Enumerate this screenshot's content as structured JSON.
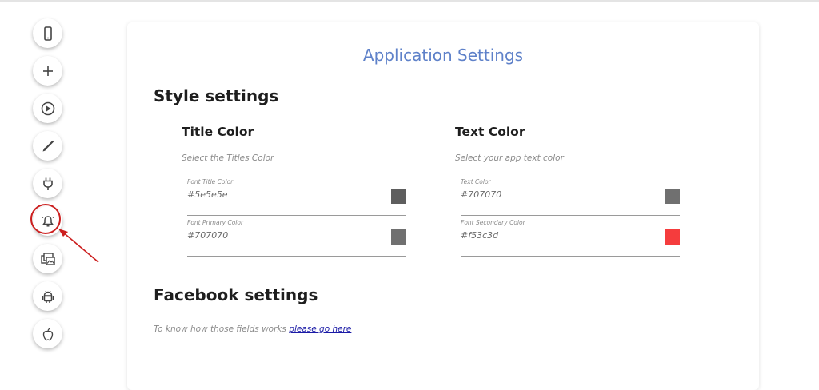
{
  "rail": {
    "items": [
      {
        "name": "mobile-icon"
      },
      {
        "name": "plus-icon"
      },
      {
        "name": "play-icon"
      },
      {
        "name": "brush-icon"
      },
      {
        "name": "plug-icon"
      },
      {
        "name": "bell-icon",
        "highlighted": true
      },
      {
        "name": "images-icon"
      },
      {
        "name": "android-icon"
      },
      {
        "name": "apple-icon"
      }
    ],
    "highlight_color": "#cc1f1f"
  },
  "page": {
    "title": "Application Settings",
    "title_color": "#5e81c9"
  },
  "style_settings": {
    "heading": "Style settings",
    "title_color": {
      "heading": "Title Color",
      "subtitle": "Select the Titles Color",
      "fields": [
        {
          "label": "Font Title Color",
          "value": "#5e5e5e",
          "swatch": "#5e5e5e"
        },
        {
          "label": "Font Primary Color",
          "value": "#707070",
          "swatch": "#707070"
        }
      ]
    },
    "text_color": {
      "heading": "Text Color",
      "subtitle": "Select your app text color",
      "fields": [
        {
          "label": "Text Color",
          "value": "#707070",
          "swatch": "#707070"
        },
        {
          "label": "Font Secondary Color",
          "value": "#f53c3d",
          "swatch": "#f53c3d"
        }
      ]
    }
  },
  "facebook_settings": {
    "heading": "Facebook settings",
    "note": "To know how those fields works",
    "link_text": "please go here"
  }
}
